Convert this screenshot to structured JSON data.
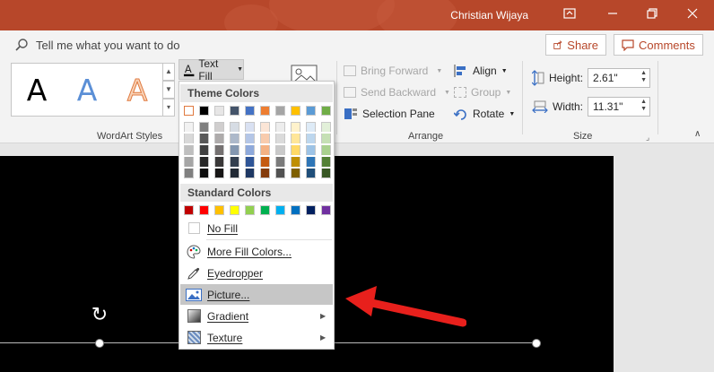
{
  "titlebar": {
    "user_name": "Christian Wijaya",
    "bg_color": "#b7472a",
    "icons": [
      "ribbon-display-icon",
      "minimize-icon",
      "restore-icon",
      "close-icon"
    ]
  },
  "tellme": {
    "placeholder": "Tell me what you want to do"
  },
  "share": {
    "label": "Share"
  },
  "comments": {
    "label": "Comments"
  },
  "wordart": {
    "styles": [
      {
        "glyph": "A",
        "style": "black-outline-white"
      },
      {
        "glyph": "A",
        "style": "blue-gradient"
      },
      {
        "glyph": "A",
        "style": "orange-outline"
      }
    ],
    "group_label": "WordArt Styles"
  },
  "text_fill": {
    "label": "Text Fill"
  },
  "arrange": {
    "bring_forward": "Bring Forward",
    "send_backward": "Send Backward",
    "selection_pane": "Selection Pane",
    "align": "Align",
    "group": "Group",
    "rotate": "Rotate",
    "group_label": "Arrange"
  },
  "size": {
    "height_label": "Height:",
    "height_value": "2.61\"",
    "width_label": "Width:",
    "width_value": "11.31\"",
    "group_label": "Size"
  },
  "menu": {
    "theme_header": "Theme Colors",
    "theme_colors": [
      "#ffffff",
      "#000000",
      "#e7e6e6",
      "#44546a",
      "#4472c4",
      "#ed7d31",
      "#a5a5a5",
      "#ffc000",
      "#5b9bd5",
      "#70ad47"
    ],
    "theme_shades": [
      [
        "#f2f2f2",
        "#d9d9d9",
        "#bfbfbf",
        "#a6a6a6",
        "#808080"
      ],
      [
        "#7f7f7f",
        "#595959",
        "#404040",
        "#262626",
        "#0d0d0d"
      ],
      [
        "#d0cece",
        "#aeabab",
        "#757171",
        "#3a3838",
        "#171616"
      ],
      [
        "#d6dce4",
        "#adb9ca",
        "#8497b0",
        "#333f4f",
        "#222a35"
      ],
      [
        "#d9e1f2",
        "#b4c6e7",
        "#8ea9db",
        "#2f5597",
        "#1f3864"
      ],
      [
        "#fbe5d6",
        "#f8cbad",
        "#f4b183",
        "#c55a11",
        "#843c0c"
      ],
      [
        "#ededed",
        "#dbdbdb",
        "#c9c9c9",
        "#7b7b7b",
        "#525252"
      ],
      [
        "#fff2cc",
        "#ffe699",
        "#ffd966",
        "#bf8f00",
        "#7f6000"
      ],
      [
        "#deebf7",
        "#bdd7ee",
        "#9dc3e6",
        "#2e75b6",
        "#1f4e79"
      ],
      [
        "#e2f0d9",
        "#c5e0b4",
        "#a9d18e",
        "#538135",
        "#375623"
      ]
    ],
    "standard_header": "Standard Colors",
    "standard_colors": [
      "#c00000",
      "#ff0000",
      "#ffc000",
      "#ffff00",
      "#92d050",
      "#00b050",
      "#00b0f0",
      "#0070c0",
      "#002060",
      "#7030a0"
    ],
    "items": [
      {
        "label": "No Fill",
        "icon": "no-fill-icon"
      },
      {
        "label": "More Fill Colors...",
        "icon": "palette-icon"
      },
      {
        "label": "Eyedropper",
        "icon": "eyedropper-icon"
      },
      {
        "label": "Picture...",
        "icon": "picture-icon"
      },
      {
        "label": "Gradient",
        "icon": "gradient-icon"
      },
      {
        "label": "Texture",
        "icon": "texture-icon"
      }
    ]
  },
  "annotation": {
    "arrow_color": "#e8201c",
    "icon": "red-arrow-icon"
  }
}
